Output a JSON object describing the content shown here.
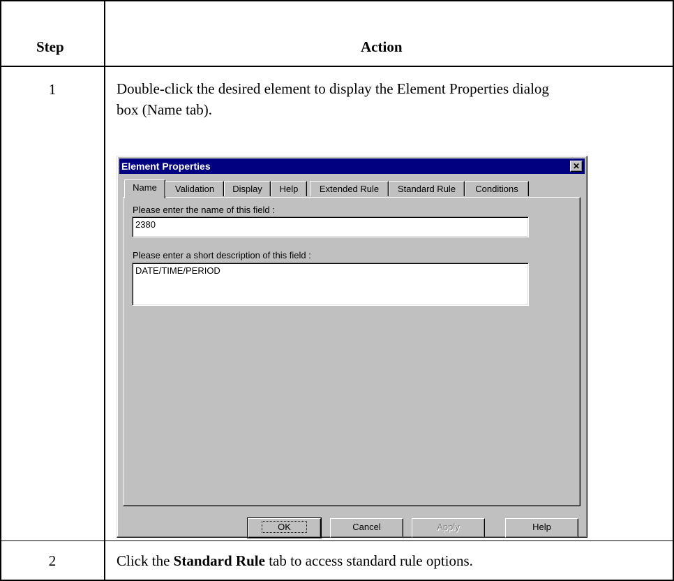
{
  "table": {
    "header_step": "Step",
    "header_action": "Action",
    "rows": [
      {
        "step": "1",
        "text_line1": "Double-click the desired element to display the Element Properties dialog",
        "text_line2": "box (Name tab)."
      },
      {
        "step": "2",
        "text_before": "Click the ",
        "text_bold": "Standard Rule",
        "text_after": " tab to access standard rule options."
      }
    ]
  },
  "dialog": {
    "title": "Element Properties",
    "close_glyph": "✕",
    "tabs": [
      "Name",
      "Validation",
      "Display",
      "Help",
      "Extended Rule",
      "Standard Rule",
      "Conditions"
    ],
    "active_tab": "Name",
    "name_label": "Please enter the name of this field :",
    "name_value": "2380",
    "desc_label": "Please enter a short description of this field :",
    "desc_value": "DATE/TIME/PERIOD",
    "buttons": {
      "ok": "OK",
      "cancel": "Cancel",
      "apply": "Apply",
      "help": "Help"
    }
  }
}
